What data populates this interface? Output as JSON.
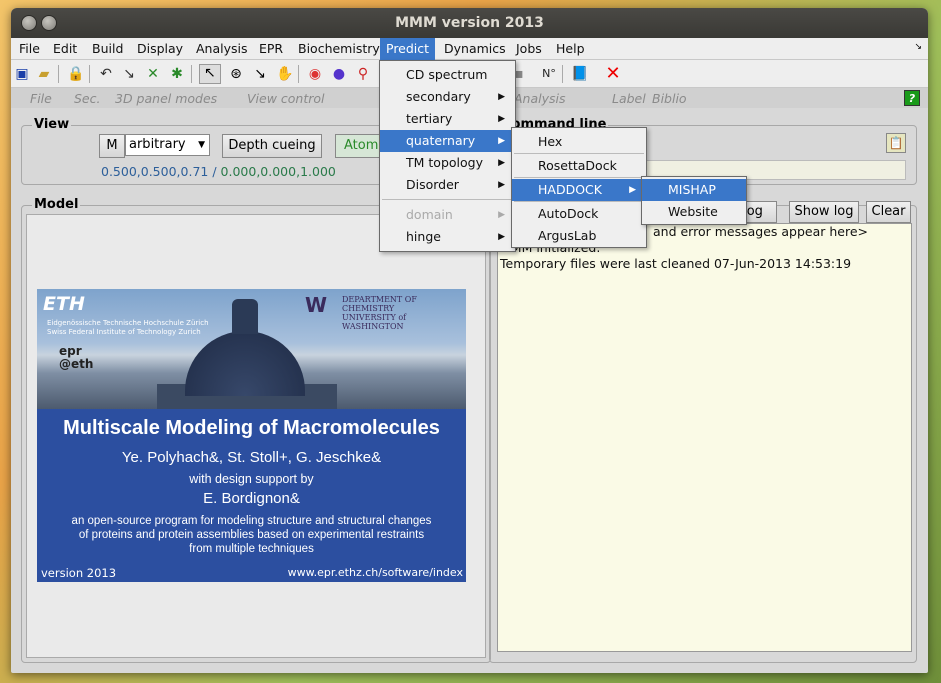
{
  "window": {
    "title": "MMM version 2013"
  },
  "menubar": [
    "File",
    "Edit",
    "Build",
    "Display",
    "Analysis",
    "EPR",
    "Biochemistry",
    "Predict",
    "Dynamics",
    "Jobs",
    "Help"
  ],
  "panel_header": {
    "items": [
      "File",
      "Sec.",
      "3D panel modes",
      "View control",
      "Analysis",
      "Label",
      "Biblio"
    ],
    "help": "?"
  },
  "view": {
    "label": "View",
    "m_button": "M",
    "mode": "arbitrary",
    "depth_cueing": "Depth cueing",
    "atom_tab": "Atom",
    "coords_a": "0.500,0.500,0.71",
    "coords_sep": "/",
    "coords_b": "0.000,0.000,1.000"
  },
  "command_line": {
    "label": "Command line"
  },
  "model": {
    "label": "Model"
  },
  "log": {
    "log_tab": "log",
    "show_log": "Show log",
    "clear": "Clear",
    "lines": [
      "and error messages appear here>",
      "MMM initialized.",
      "Temporary files were last cleaned 07-Jun-2013 14:53:19"
    ]
  },
  "splash": {
    "eth": "ETH",
    "eth_sub1": "Eidgenössische Technische Hochschule Zürich",
    "eth_sub2": "Swiss Federal Institute of Technology Zurich",
    "uw_w": "W",
    "uw_dept": "DEPARTMENT OF CHEMISTRY",
    "uw_univ": "UNIVERSITY of WASHINGTON",
    "epr": "epr",
    "at_eth": "@eth",
    "title": "Multiscale Modeling of Macromolecules",
    "authors": "Ye. Polyhach&, St. Stoll+, G. Jeschke&",
    "design": "with design support by",
    "designer": "E. Bordignon&",
    "desc1": "an open-source program for modeling structure and structural changes",
    "desc2": "of proteins and protein assemblies based on experimental restraints",
    "desc3": "from multiple techniques",
    "version": "version 2013",
    "url": "www.epr.ethz.ch/software/index"
  },
  "predict_menu": [
    {
      "label": "CD spectrum",
      "submenu": false
    },
    {
      "label": "secondary",
      "submenu": true
    },
    {
      "label": "tertiary",
      "submenu": true
    },
    {
      "label": "quaternary",
      "submenu": true,
      "selected": true
    },
    {
      "label": "TM topology",
      "submenu": true
    },
    {
      "label": "Disorder",
      "submenu": true
    },
    {
      "label": "domain",
      "submenu": true,
      "disabled": true
    },
    {
      "label": "hinge",
      "submenu": true
    }
  ],
  "quaternary_menu": [
    {
      "label": "Hex"
    },
    {
      "label": "RosettaDock"
    },
    {
      "label": "HADDOCK",
      "submenu": true,
      "selected": true
    },
    {
      "label": "AutoDock"
    },
    {
      "label": "ArgusLab"
    }
  ],
  "haddock_menu": [
    {
      "label": "MISHAP",
      "selected": true
    },
    {
      "label": "Website"
    }
  ]
}
